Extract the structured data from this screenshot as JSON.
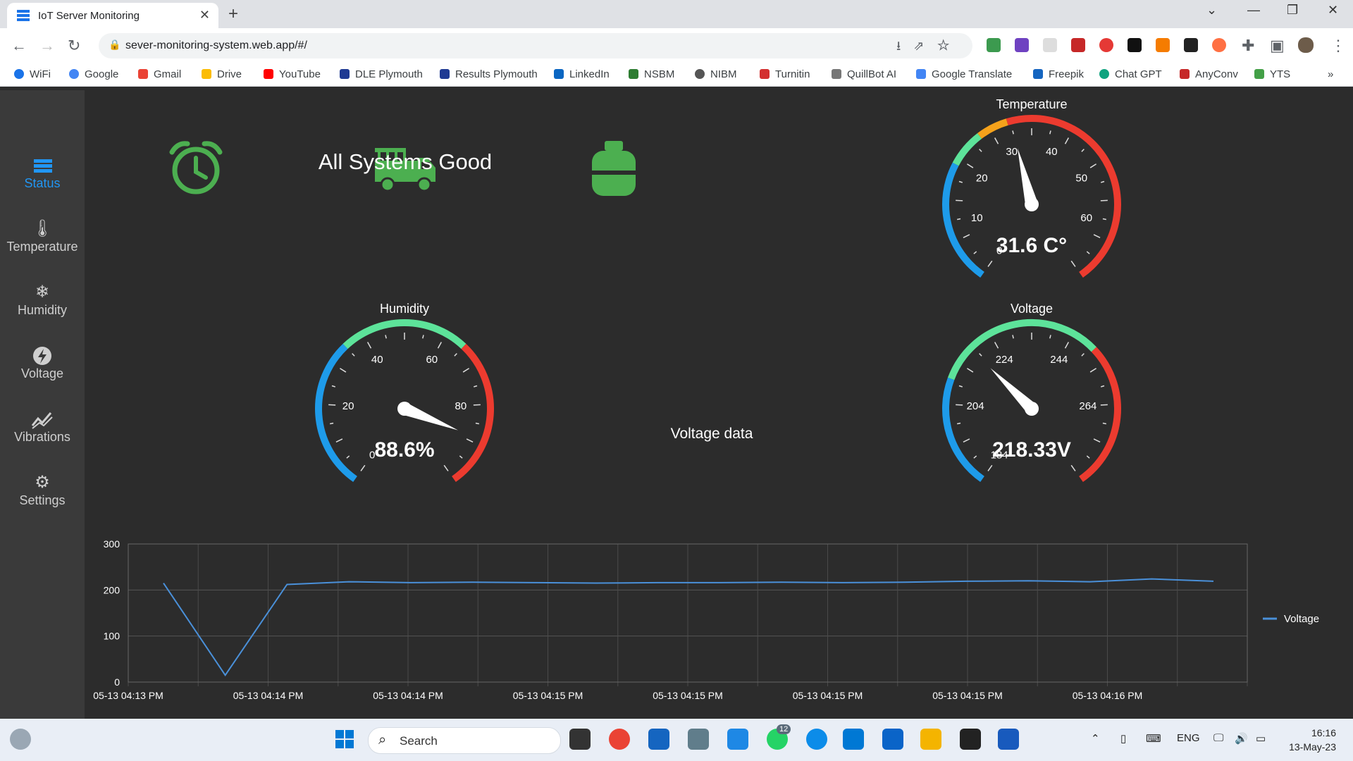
{
  "browser": {
    "tab_title": "IoT Server Monitoring",
    "url": "sever-monitoring-system.web.app/#/",
    "bookmarks": [
      "WiFi",
      "Google",
      "Gmail",
      "Drive",
      "YouTube",
      "DLE Plymouth",
      "Results Plymouth",
      "LinkedIn",
      "NSBM",
      "NIBM",
      "Turnitin",
      "QuillBot AI",
      "Google Translate",
      "Freepik",
      "Chat GPT",
      "AnyConv",
      "YTS"
    ]
  },
  "sidebar": {
    "items": [
      {
        "label": "Status",
        "icon": "server-stack-icon"
      },
      {
        "label": "Temperature",
        "icon": "thermometer-icon"
      },
      {
        "label": "Humidity",
        "icon": "snowflake-icon"
      },
      {
        "label": "Voltage",
        "icon": "bolt-icon"
      },
      {
        "label": "Vibrations",
        "icon": "wave-chart-icon"
      },
      {
        "label": "Settings",
        "icon": "gear-icon"
      }
    ]
  },
  "status": {
    "message": "All Systems Good",
    "icons": [
      "alarm-clock-icon",
      "fire-truck-icon",
      "gas-cylinder-icon"
    ],
    "ok_color": "#4caf50"
  },
  "gauges": {
    "temperature": {
      "title": "Temperature",
      "display": "31.6 C°",
      "value": 31.6,
      "min": 0,
      "max": 70,
      "ticks": [
        0,
        10,
        20,
        30,
        40,
        50,
        60
      ]
    },
    "humidity": {
      "title": "Humidity",
      "display": "88.6%",
      "value": 88.6,
      "min": 0,
      "max": 100,
      "ticks": [
        0,
        20,
        40,
        60,
        80
      ]
    },
    "voltage": {
      "title": "Voltage",
      "display": "218.33V",
      "value": 218.33,
      "min": 184,
      "max": 284,
      "ticks": [
        184,
        204,
        224,
        244,
        264
      ]
    }
  },
  "chart_data": {
    "type": "line",
    "title": "Voltage data",
    "x": [
      "05-13 04:13 PM",
      "05-13 04:14 PM",
      "05-13 04:14 PM",
      "05-13 04:15 PM",
      "05-13 04:15 PM",
      "05-13 04:15 PM",
      "05-13 04:15 PM",
      "05-13 04:16 PM"
    ],
    "series": [
      {
        "name": "Voltage",
        "values": [
          215,
          15,
          212,
          218,
          216,
          217,
          216,
          215,
          216,
          216,
          217,
          216,
          217,
          219,
          220,
          218,
          224,
          219
        ]
      }
    ],
    "ylim": [
      0,
      300
    ],
    "yticks": [
      0,
      100,
      200,
      300
    ],
    "legend": "right",
    "grid": true,
    "line_color": "#4a90d9"
  },
  "taskbar": {
    "search_placeholder": "Search",
    "language": "ENG",
    "time": "16:16",
    "date": "13-May-23",
    "whatsapp_badge": "12"
  }
}
